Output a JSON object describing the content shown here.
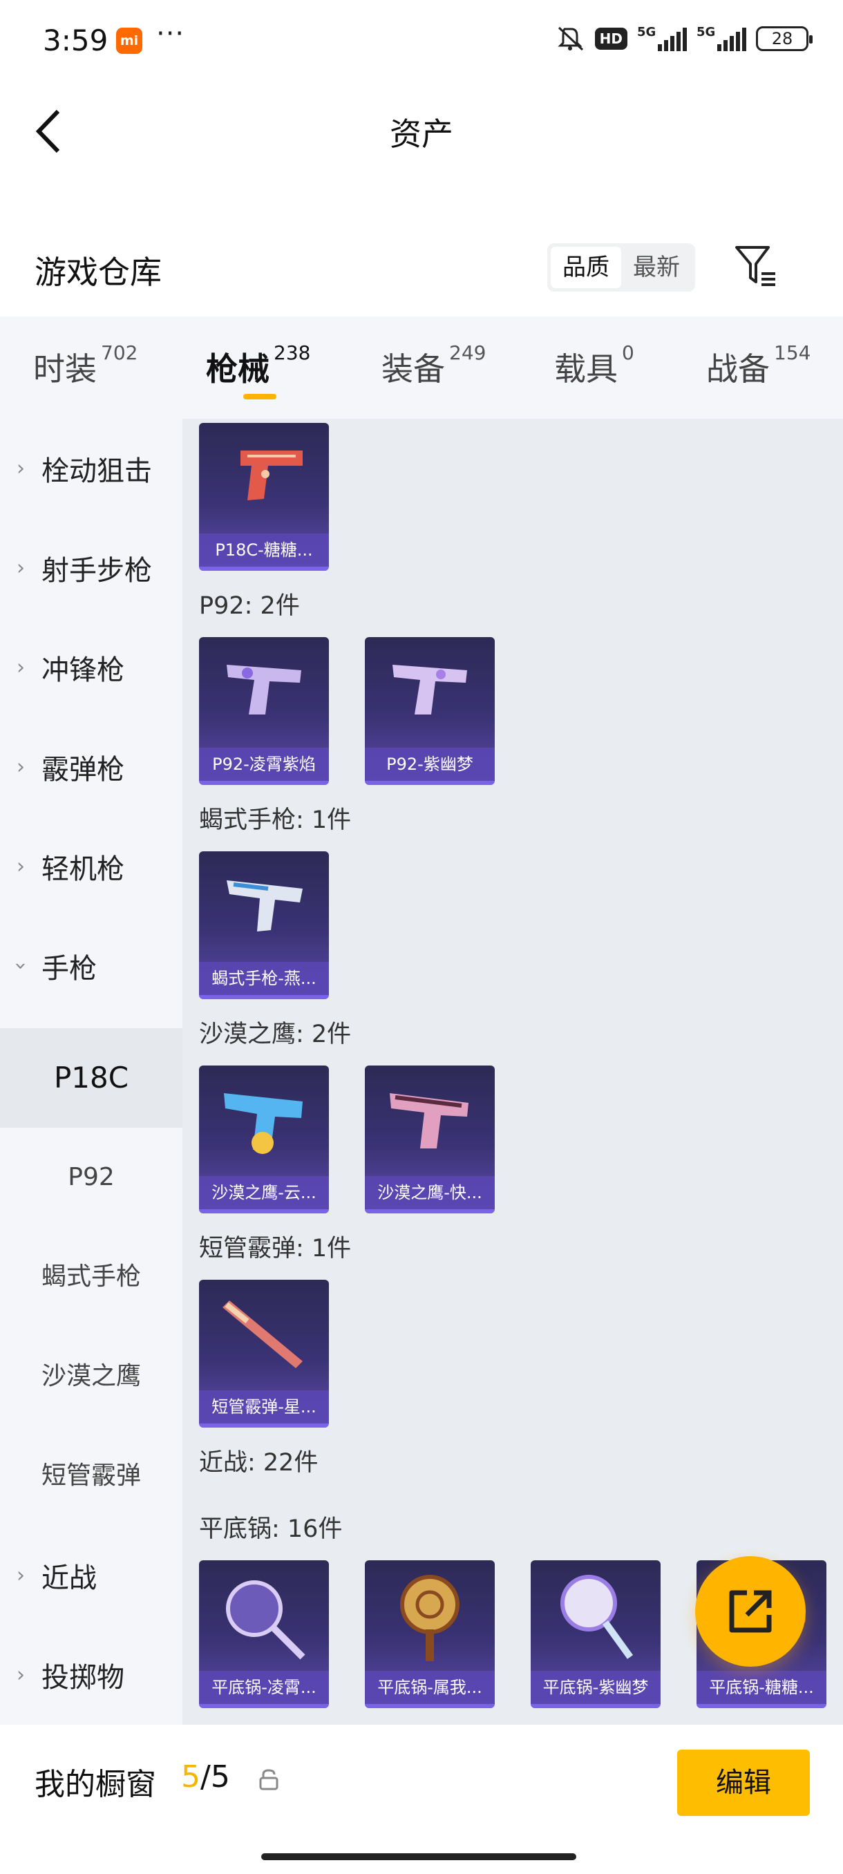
{
  "status": {
    "time": "3:59",
    "mi_badge": "mi",
    "dots": "···",
    "hd": "HD",
    "net1": "5G",
    "net2": "5G",
    "battery": "28"
  },
  "header": {
    "title": "资产"
  },
  "warehouse": {
    "title": "游戏仓库",
    "sort_options": [
      "品质",
      "最新"
    ],
    "sort_active": "品质"
  },
  "tabs": [
    {
      "label": "时装",
      "count": "702"
    },
    {
      "label": "枪械",
      "count": "238"
    },
    {
      "label": "装备",
      "count": "249"
    },
    {
      "label": "载具",
      "count": "0"
    },
    {
      "label": "战备",
      "count": "154"
    }
  ],
  "active_tab": "枪械",
  "sidebar": {
    "categories": [
      "栓动狙击",
      "射手步枪",
      "冲锋枪",
      "霰弹枪",
      "轻机枪",
      "手枪",
      "近战",
      "投掷物"
    ],
    "expanded": "手枪",
    "pistol_subs": [
      "P18C",
      "P92",
      "蝎式手枪",
      "沙漠之鹰",
      "短管霰弹"
    ],
    "active_sub": "P18C"
  },
  "content": {
    "groups": [
      {
        "label": "",
        "items": [
          "P18C-糖糖..."
        ]
      },
      {
        "label": "P92: 2件",
        "items": [
          "P92-凌霄紫焰",
          "P92-紫幽梦"
        ]
      },
      {
        "label": "蝎式手枪: 1件",
        "items": [
          "蝎式手枪-燕..."
        ]
      },
      {
        "label": "沙漠之鹰: 2件",
        "items": [
          "沙漠之鹰-云...",
          "沙漠之鹰-快..."
        ]
      },
      {
        "label": "短管霰弹: 1件",
        "items": [
          "短管霰弹-星..."
        ]
      },
      {
        "label": "近战: 22件",
        "items": []
      },
      {
        "label": "平底锅: 16件",
        "items": [
          "平底锅-凌霄...",
          "平底锅-属我...",
          "平底锅-紫幽梦",
          "平底锅-糖糖..."
        ]
      }
    ]
  },
  "bottom": {
    "title": "我的橱窗",
    "count_current": "5",
    "count_sep": "/",
    "count_total": "5",
    "edit_label": "编辑"
  },
  "colors": {
    "accent": "#ffb400",
    "tab_bg": "#f4f6f9",
    "content_bg": "#e9edf2",
    "card_border": "#7a63e6"
  }
}
